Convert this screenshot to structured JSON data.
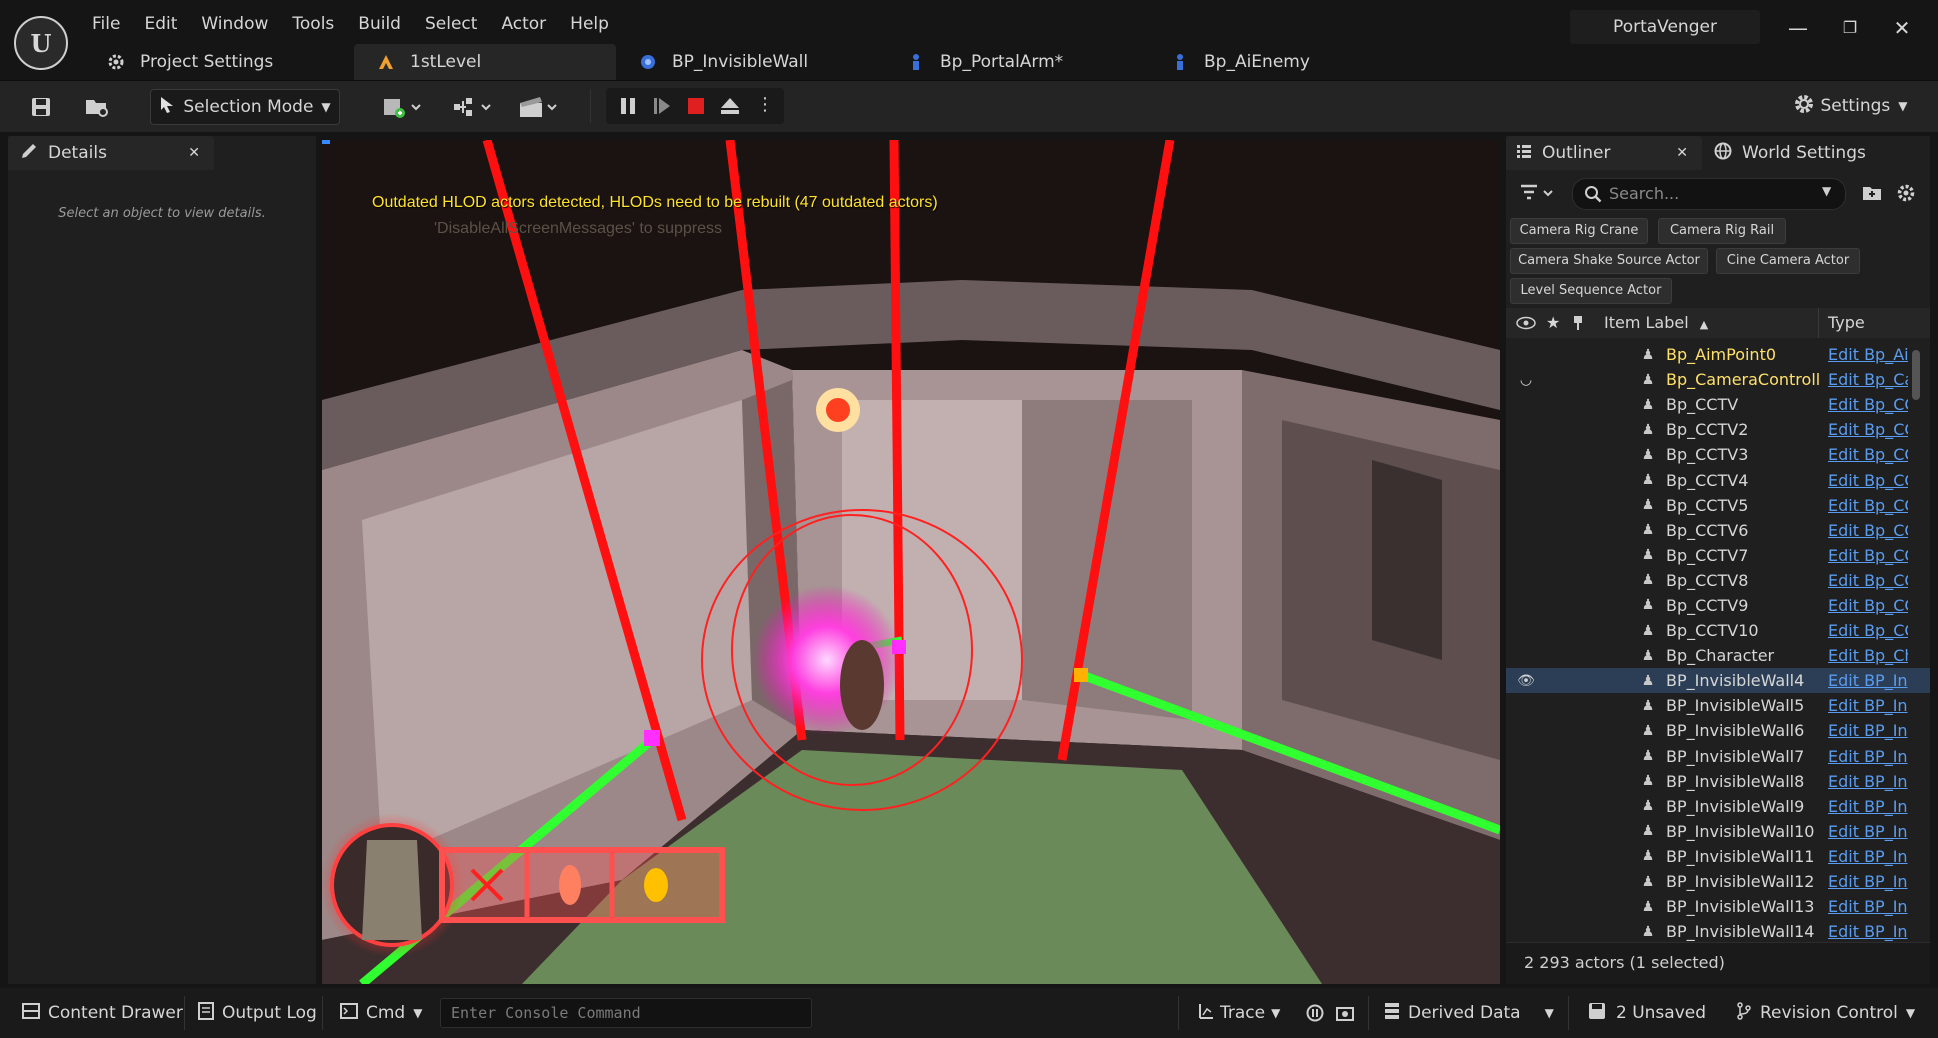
{
  "app": {
    "menu": [
      "File",
      "Edit",
      "Window",
      "Tools",
      "Build",
      "Select",
      "Actor",
      "Help"
    ],
    "project_name": "PortaVenger",
    "logo_text": "U"
  },
  "tabs": [
    {
      "label": "Project Settings",
      "icon": "gear-icon"
    },
    {
      "label": "1stLevel",
      "icon": "level-icon"
    },
    {
      "label": "BP_InvisibleWall",
      "icon": "blueprint-icon"
    },
    {
      "label": "Bp_PortalArm*",
      "icon": "character-icon"
    },
    {
      "label": "Bp_AiEnemy",
      "icon": "character-icon"
    }
  ],
  "toolbar": {
    "mode": "Selection Mode",
    "settings": "Settings"
  },
  "details": {
    "title": "Details",
    "empty": "Select an object to view details."
  },
  "viewport": {
    "hlod_message": "Outdated HLOD actors detected, HLODs need to be rebuilt (47 outdated actors)",
    "hlod_sub": "'DisableAllScreenMessages' to suppress"
  },
  "outliner": {
    "title": "Outliner",
    "world_settings": "World Settings",
    "search_placeholder": "Search...",
    "chips": [
      "Camera Rig Crane",
      "Camera Rig Rail",
      "Camera Shake Source Actor",
      "Cine Camera Actor",
      "Level Sequence Actor"
    ],
    "col_label": "Item Label",
    "col_type": "Type",
    "rows": [
      {
        "label": "Bp_AimPoint0",
        "type": "Edit Bp_Ai",
        "yellow": true
      },
      {
        "label": "Bp_CameraControll",
        "type": "Edit Bp_Ca",
        "yellow": true
      },
      {
        "label": "Bp_CCTV",
        "type": "Edit Bp_CC"
      },
      {
        "label": "Bp_CCTV2",
        "type": "Edit Bp_CC"
      },
      {
        "label": "Bp_CCTV3",
        "type": "Edit Bp_CC"
      },
      {
        "label": "Bp_CCTV4",
        "type": "Edit Bp_CC"
      },
      {
        "label": "Bp_CCTV5",
        "type": "Edit Bp_CC"
      },
      {
        "label": "Bp_CCTV6",
        "type": "Edit Bp_CC"
      },
      {
        "label": "Bp_CCTV7",
        "type": "Edit Bp_CC"
      },
      {
        "label": "Bp_CCTV8",
        "type": "Edit Bp_CC"
      },
      {
        "label": "Bp_CCTV9",
        "type": "Edit Bp_CC"
      },
      {
        "label": "Bp_CCTV10",
        "type": "Edit Bp_CC"
      },
      {
        "label": "Bp_Character",
        "type": "Edit Bp_Ch"
      },
      {
        "label": "BP_InvisibleWall4",
        "type": "Edit BP_In",
        "selected": true
      },
      {
        "label": "BP_InvisibleWall5",
        "type": "Edit BP_In"
      },
      {
        "label": "BP_InvisibleWall6",
        "type": "Edit BP_In"
      },
      {
        "label": "BP_InvisibleWall7",
        "type": "Edit BP_In"
      },
      {
        "label": "BP_InvisibleWall8",
        "type": "Edit BP_In"
      },
      {
        "label": "BP_InvisibleWall9",
        "type": "Edit BP_In"
      },
      {
        "label": "BP_InvisibleWall10",
        "type": "Edit BP_In"
      },
      {
        "label": "BP_InvisibleWall11",
        "type": "Edit BP_In"
      },
      {
        "label": "BP_InvisibleWall12",
        "type": "Edit BP_In"
      },
      {
        "label": "BP_InvisibleWall13",
        "type": "Edit BP_In"
      },
      {
        "label": "BP_InvisibleWall14",
        "type": "Edit BP_In"
      }
    ],
    "status": "2 293 actors (1 selected)"
  },
  "bottom": {
    "content_drawer": "Content Drawer",
    "output_log": "Output Log",
    "cmd": "Cmd",
    "console_placeholder": "Enter Console Command",
    "trace": "Trace",
    "derived_data": "Derived Data",
    "unsaved": "2 Unsaved",
    "revision": "Revision Control"
  },
  "colors": {
    "accent_blue": "#5a9cf0",
    "hlod_yellow": "#ffe32a",
    "selection": "#2c3e56"
  }
}
